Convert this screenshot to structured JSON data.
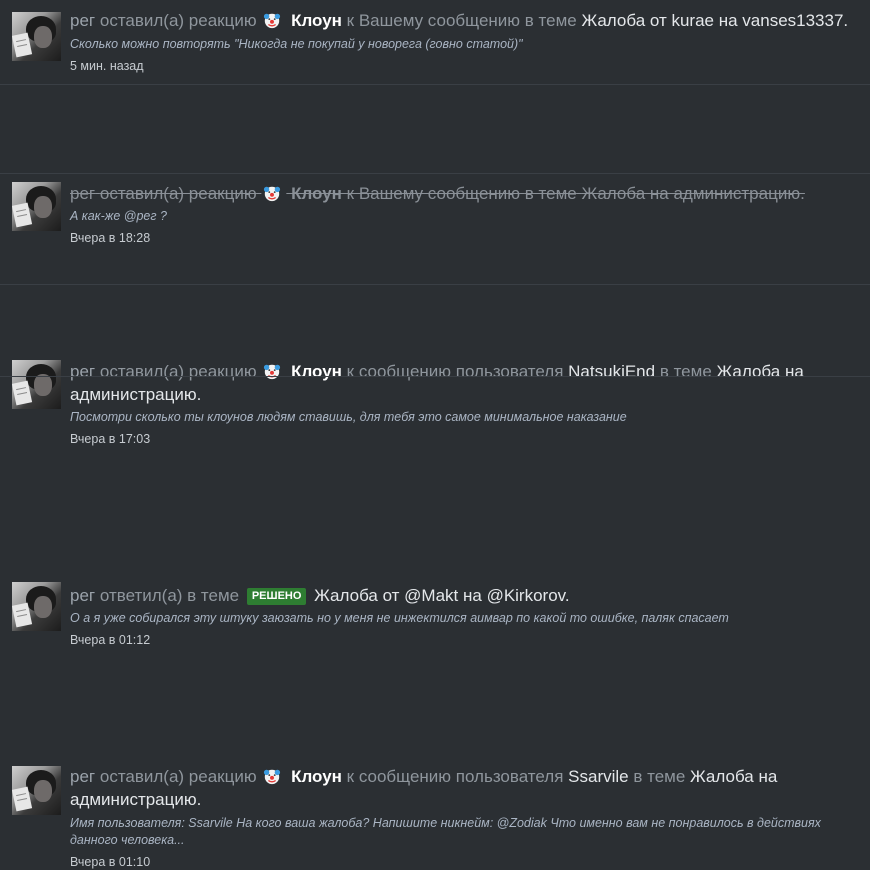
{
  "alerts": [
    {
      "user": "рег",
      "action": "оставил(а) реакцию",
      "reaction": "Клоун",
      "target": "к Вашему сообщению",
      "in_thread": "в теме",
      "thread": "Жалоба от kurae на vanses13337.",
      "snippet": "Сколько можно повторять \"Никогда не покупай у новорега (говно статой)\"",
      "time": "5 мин. назад"
    },
    {
      "user": "рег",
      "action": "оставил(а) реакцию",
      "reaction": "Клоун",
      "target": "к Вашему сообщению",
      "in_thread": "в теме",
      "thread": "Жалоба на администрацию.",
      "snippet": "А как-же @рег ?",
      "time": "Вчера в 18:28"
    },
    {
      "user": "рег",
      "action": "оставил(а) реакцию",
      "reaction": "Клоун",
      "target_prefix": "к сообщению пользователя",
      "target_user": "NatsukiEnd",
      "in_thread": "в теме",
      "thread": "Жалоба на администрацию.",
      "snippet": "Посмотри сколько ты клоунов людям ставишь, для тебя это самое минимальное наказание",
      "time": "Вчера в 17:03"
    },
    {
      "user": "рег",
      "action": "ответил(а) в теме",
      "badge": "РЕШЕНО",
      "thread": "Жалоба от @Makt на @Kirkorov.",
      "snippet": "О а я уже собирался эту штуку заюзать но у меня не инжектился аимвар по какой то ошибке, паляк спасает",
      "time": "Вчера в 01:12"
    },
    {
      "user": "рег",
      "action": "оставил(а) реакцию",
      "reaction": "Клоун",
      "target_prefix": "к сообщению пользователя",
      "target_user": "Ssarvile",
      "in_thread": "в теме",
      "thread": "Жалоба на администрацию.",
      "snippet": "Имя пользователя: Ssarvile На кого ваша жалоба? Напишите никнейм: @Zodiak Что именно вам не понравилось в действиях данного человека...",
      "time": "Вчера в 01:10"
    }
  ],
  "icons": {
    "reaction": "clown-emoji-icon",
    "avatar": "user-avatar"
  },
  "colors": {
    "background": "#2b2f33",
    "snippet": "#aab5c4",
    "badge": "#2e7d32"
  }
}
